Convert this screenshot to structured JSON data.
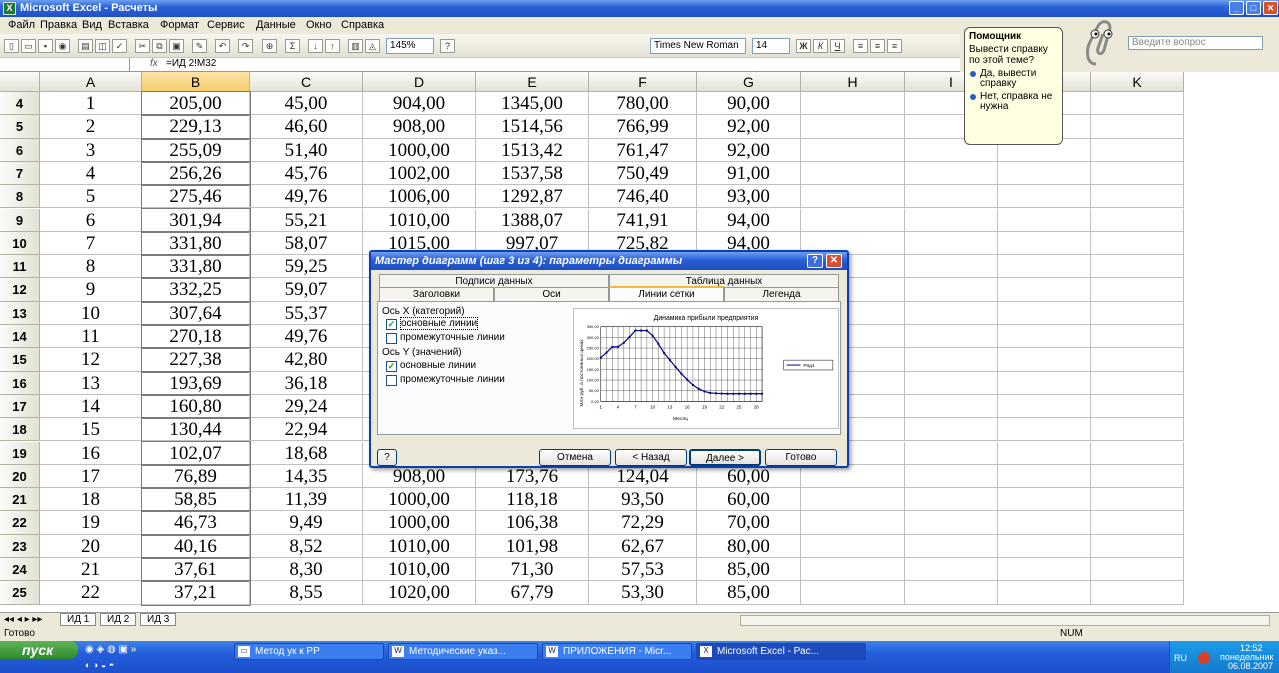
{
  "window": {
    "title": "Microsoft Excel - Расчеты",
    "app_icon": "excel-icon"
  },
  "menu": [
    "Файл",
    "Правка",
    "Вид",
    "Вставка",
    "Формат",
    "Сервис",
    "Данные",
    "Окно",
    "Справка"
  ],
  "toolbar": {
    "zoom": "145%",
    "font_name": "Times New Roman",
    "font_size": "14",
    "bold": "Ж",
    "italic": "К",
    "underline": "Ч"
  },
  "formula_bar": {
    "cell_ref": "",
    "fx": "fx",
    "formula": "=ИД 2!M32"
  },
  "grid": {
    "columns": [
      "A",
      "B",
      "C",
      "D",
      "E",
      "F",
      "G",
      "H",
      "I",
      "J",
      "K"
    ],
    "rows": [
      {
        "n": "4",
        "cells": [
          "1",
          "205,00",
          "45,00",
          "904,00",
          "1345,00",
          "780,00",
          "90,00"
        ]
      },
      {
        "n": "5",
        "cells": [
          "2",
          "229,13",
          "46,60",
          "908,00",
          "1514,56",
          "766,99",
          "92,00"
        ]
      },
      {
        "n": "6",
        "cells": [
          "3",
          "255,09",
          "51,40",
          "1000,00",
          "1513,42",
          "761,47",
          "92,00"
        ]
      },
      {
        "n": "7",
        "cells": [
          "4",
          "256,26",
          "45,76",
          "1002,00",
          "1537,58",
          "750,49",
          "91,00"
        ]
      },
      {
        "n": "8",
        "cells": [
          "5",
          "275,46",
          "49,76",
          "1006,00",
          "1292,87",
          "746,40",
          "93,00"
        ]
      },
      {
        "n": "9",
        "cells": [
          "6",
          "301,94",
          "55,21",
          "1010,00",
          "1388,07",
          "741,91",
          "94,00"
        ]
      },
      {
        "n": "10",
        "cells": [
          "7",
          "331,80",
          "58,07",
          "1015,00",
          "997,07",
          "725,82",
          "94,00"
        ]
      },
      {
        "n": "11",
        "cells": [
          "8",
          "331,80",
          "59,25",
          "",
          "",
          "",
          ""
        ]
      },
      {
        "n": "12",
        "cells": [
          "9",
          "332,25",
          "59,07",
          "",
          "",
          "",
          ""
        ]
      },
      {
        "n": "13",
        "cells": [
          "10",
          "307,64",
          "55,37",
          "",
          "",
          "",
          ""
        ]
      },
      {
        "n": "14",
        "cells": [
          "11",
          "270,18",
          "49,76",
          "",
          "",
          "",
          ""
        ]
      },
      {
        "n": "15",
        "cells": [
          "12",
          "227,38",
          "42,80",
          "",
          "",
          "",
          ""
        ]
      },
      {
        "n": "16",
        "cells": [
          "13",
          "193,69",
          "36,18",
          "",
          "",
          "",
          ""
        ]
      },
      {
        "n": "17",
        "cells": [
          "14",
          "160,80",
          "29,24",
          "",
          "",
          "",
          ""
        ]
      },
      {
        "n": "18",
        "cells": [
          "15",
          "130,44",
          "22,94",
          "",
          "",
          "",
          ""
        ]
      },
      {
        "n": "19",
        "cells": [
          "16",
          "102,07",
          "18,68",
          "",
          "",
          "",
          ""
        ]
      },
      {
        "n": "20",
        "cells": [
          "17",
          "76,89",
          "14,35",
          "908,00",
          "173,76",
          "124,04",
          "60,00"
        ]
      },
      {
        "n": "21",
        "cells": [
          "18",
          "58,85",
          "11,39",
          "1000,00",
          "118,18",
          "93,50",
          "60,00"
        ]
      },
      {
        "n": "22",
        "cells": [
          "19",
          "46,73",
          "9,49",
          "1000,00",
          "106,38",
          "72,29",
          "70,00"
        ]
      },
      {
        "n": "23",
        "cells": [
          "20",
          "40,16",
          "8,52",
          "1010,00",
          "101,98",
          "62,67",
          "80,00"
        ]
      },
      {
        "n": "24",
        "cells": [
          "21",
          "37,61",
          "8,30",
          "1010,00",
          "71,30",
          "57,53",
          "85,00"
        ]
      },
      {
        "n": "25",
        "cells": [
          "22",
          "37,21",
          "8,55",
          "1020,00",
          "67,79",
          "53,30",
          "85,00"
        ]
      }
    ]
  },
  "sheet_tabs": [
    "ИД 1",
    "ИД 2",
    "ИД 3"
  ],
  "status": {
    "left": "Готово",
    "num": "NUM"
  },
  "assistant": {
    "title": "Помощник",
    "question": "Вывести справку по этой теме?",
    "option_yes": "Да, вывести справку",
    "option_no": "Нет, справка не нужна",
    "ask_placeholder": "Введите вопрос"
  },
  "dialog": {
    "title": "Мастер диаграмм (шаг 3 из 4): параметры диаграммы",
    "tabs_top": [
      "Подписи данных",
      "Таблица данных"
    ],
    "tabs_bottom": [
      "Заголовки",
      "Оси",
      "Линии сетки",
      "Легенда"
    ],
    "active_tab": "Линии сетки",
    "x_axis_group": "Ось X (категорий)",
    "x_major": "основные линии",
    "x_minor": "промежуточные линии",
    "y_axis_group": "Ось Y (значений)",
    "y_major": "основные линии",
    "y_minor": "промежуточные линии",
    "buttons": {
      "help": "?",
      "cancel": "Отмена",
      "back": "< Назад",
      "next": "Далее >",
      "finish": "Готово"
    }
  },
  "chart_data": {
    "type": "line",
    "title": "Динамика прибыли предприятия",
    "xlabel": "Месяц",
    "ylabel": "Млн руб. в постоянных ценах",
    "x_ticks": [
      "1",
      "4",
      "7",
      "10",
      "13",
      "16",
      "19",
      "22",
      "25",
      "28"
    ],
    "y_ticks": [
      "0,00",
      "50,00",
      "100,00",
      "150,00",
      "200,00",
      "250,00",
      "300,00",
      "350,00"
    ],
    "ylim": [
      0,
      350
    ],
    "grid": true,
    "legend": "right",
    "series": [
      {
        "name": "Ряд1",
        "x": [
          1,
          2,
          3,
          4,
          5,
          6,
          7,
          8,
          9,
          10,
          11,
          12,
          13,
          14,
          15,
          16,
          17,
          18,
          19,
          20,
          21,
          22,
          23,
          24,
          25,
          26,
          27,
          28,
          29
        ],
        "values": [
          205,
          229,
          255,
          256,
          275,
          302,
          332,
          332,
          332,
          308,
          270,
          227,
          194,
          161,
          130,
          102,
          77,
          59,
          47,
          40,
          38,
          37,
          36,
          36,
          36,
          36,
          36,
          36,
          36
        ]
      }
    ]
  },
  "taskbar": {
    "start": "пуск",
    "items": [
      "Метод ук к РР",
      "Методические указ...",
      "ПРИЛОЖЕНИЯ - Micr...",
      "Microsoft Excel - Рас..."
    ],
    "lang": "RU",
    "time": "12:52",
    "day": "понедельник",
    "date": "06.08.2007"
  }
}
